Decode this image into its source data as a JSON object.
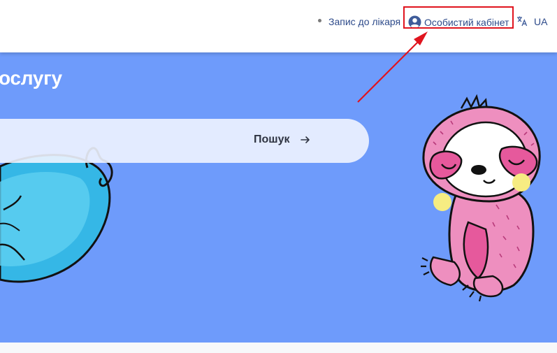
{
  "header": {
    "nav_appointment": "Запис до лікаря",
    "nav_cabinet": "Особистий кабінет",
    "language": "UA"
  },
  "hero": {
    "title": "ослугу",
    "search_button": "Пошук"
  },
  "icons": {
    "cabinet": "user-circle-icon",
    "language": "translate-icon",
    "search_button": "arrow-right-icon"
  },
  "colors": {
    "hero_background": "#6e9bfb",
    "nav_text": "#2d4a8a",
    "annotation": "#e0141e",
    "sloth_pink": "#ee8fbf",
    "blue_character": "#35b7e6"
  }
}
